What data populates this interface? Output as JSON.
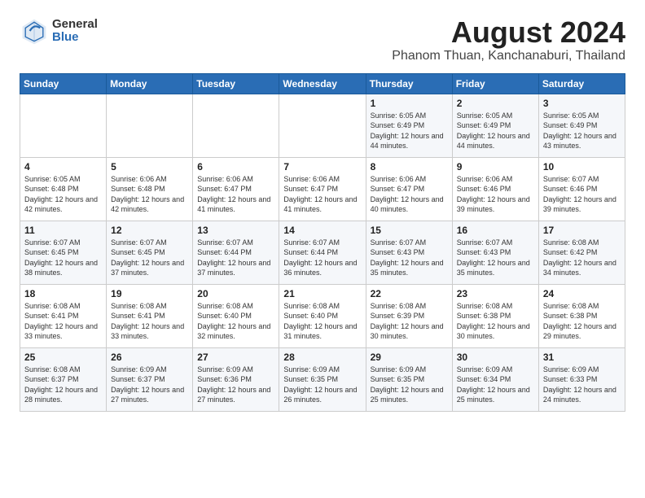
{
  "logo": {
    "general": "General",
    "blue": "Blue"
  },
  "title": "August 2024",
  "subtitle": "Phanom Thuan, Kanchanaburi, Thailand",
  "headers": [
    "Sunday",
    "Monday",
    "Tuesday",
    "Wednesday",
    "Thursday",
    "Friday",
    "Saturday"
  ],
  "weeks": [
    [
      {
        "day": "",
        "info": ""
      },
      {
        "day": "",
        "info": ""
      },
      {
        "day": "",
        "info": ""
      },
      {
        "day": "",
        "info": ""
      },
      {
        "day": "1",
        "info": "Sunrise: 6:05 AM\nSunset: 6:49 PM\nDaylight: 12 hours\nand 44 minutes."
      },
      {
        "day": "2",
        "info": "Sunrise: 6:05 AM\nSunset: 6:49 PM\nDaylight: 12 hours\nand 44 minutes."
      },
      {
        "day": "3",
        "info": "Sunrise: 6:05 AM\nSunset: 6:49 PM\nDaylight: 12 hours\nand 43 minutes."
      }
    ],
    [
      {
        "day": "4",
        "info": "Sunrise: 6:05 AM\nSunset: 6:48 PM\nDaylight: 12 hours\nand 42 minutes."
      },
      {
        "day": "5",
        "info": "Sunrise: 6:06 AM\nSunset: 6:48 PM\nDaylight: 12 hours\nand 42 minutes."
      },
      {
        "day": "6",
        "info": "Sunrise: 6:06 AM\nSunset: 6:47 PM\nDaylight: 12 hours\nand 41 minutes."
      },
      {
        "day": "7",
        "info": "Sunrise: 6:06 AM\nSunset: 6:47 PM\nDaylight: 12 hours\nand 41 minutes."
      },
      {
        "day": "8",
        "info": "Sunrise: 6:06 AM\nSunset: 6:47 PM\nDaylight: 12 hours\nand 40 minutes."
      },
      {
        "day": "9",
        "info": "Sunrise: 6:06 AM\nSunset: 6:46 PM\nDaylight: 12 hours\nand 39 minutes."
      },
      {
        "day": "10",
        "info": "Sunrise: 6:07 AM\nSunset: 6:46 PM\nDaylight: 12 hours\nand 39 minutes."
      }
    ],
    [
      {
        "day": "11",
        "info": "Sunrise: 6:07 AM\nSunset: 6:45 PM\nDaylight: 12 hours\nand 38 minutes."
      },
      {
        "day": "12",
        "info": "Sunrise: 6:07 AM\nSunset: 6:45 PM\nDaylight: 12 hours\nand 37 minutes."
      },
      {
        "day": "13",
        "info": "Sunrise: 6:07 AM\nSunset: 6:44 PM\nDaylight: 12 hours\nand 37 minutes."
      },
      {
        "day": "14",
        "info": "Sunrise: 6:07 AM\nSunset: 6:44 PM\nDaylight: 12 hours\nand 36 minutes."
      },
      {
        "day": "15",
        "info": "Sunrise: 6:07 AM\nSunset: 6:43 PM\nDaylight: 12 hours\nand 35 minutes."
      },
      {
        "day": "16",
        "info": "Sunrise: 6:07 AM\nSunset: 6:43 PM\nDaylight: 12 hours\nand 35 minutes."
      },
      {
        "day": "17",
        "info": "Sunrise: 6:08 AM\nSunset: 6:42 PM\nDaylight: 12 hours\nand 34 minutes."
      }
    ],
    [
      {
        "day": "18",
        "info": "Sunrise: 6:08 AM\nSunset: 6:41 PM\nDaylight: 12 hours\nand 33 minutes."
      },
      {
        "day": "19",
        "info": "Sunrise: 6:08 AM\nSunset: 6:41 PM\nDaylight: 12 hours\nand 33 minutes."
      },
      {
        "day": "20",
        "info": "Sunrise: 6:08 AM\nSunset: 6:40 PM\nDaylight: 12 hours\nand 32 minutes."
      },
      {
        "day": "21",
        "info": "Sunrise: 6:08 AM\nSunset: 6:40 PM\nDaylight: 12 hours\nand 31 minutes."
      },
      {
        "day": "22",
        "info": "Sunrise: 6:08 AM\nSunset: 6:39 PM\nDaylight: 12 hours\nand 30 minutes."
      },
      {
        "day": "23",
        "info": "Sunrise: 6:08 AM\nSunset: 6:38 PM\nDaylight: 12 hours\nand 30 minutes."
      },
      {
        "day": "24",
        "info": "Sunrise: 6:08 AM\nSunset: 6:38 PM\nDaylight: 12 hours\nand 29 minutes."
      }
    ],
    [
      {
        "day": "25",
        "info": "Sunrise: 6:08 AM\nSunset: 6:37 PM\nDaylight: 12 hours\nand 28 minutes."
      },
      {
        "day": "26",
        "info": "Sunrise: 6:09 AM\nSunset: 6:37 PM\nDaylight: 12 hours\nand 27 minutes."
      },
      {
        "day": "27",
        "info": "Sunrise: 6:09 AM\nSunset: 6:36 PM\nDaylight: 12 hours\nand 27 minutes."
      },
      {
        "day": "28",
        "info": "Sunrise: 6:09 AM\nSunset: 6:35 PM\nDaylight: 12 hours\nand 26 minutes."
      },
      {
        "day": "29",
        "info": "Sunrise: 6:09 AM\nSunset: 6:35 PM\nDaylight: 12 hours\nand 25 minutes."
      },
      {
        "day": "30",
        "info": "Sunrise: 6:09 AM\nSunset: 6:34 PM\nDaylight: 12 hours\nand 25 minutes."
      },
      {
        "day": "31",
        "info": "Sunrise: 6:09 AM\nSunset: 6:33 PM\nDaylight: 12 hours\nand 24 minutes."
      }
    ]
  ]
}
